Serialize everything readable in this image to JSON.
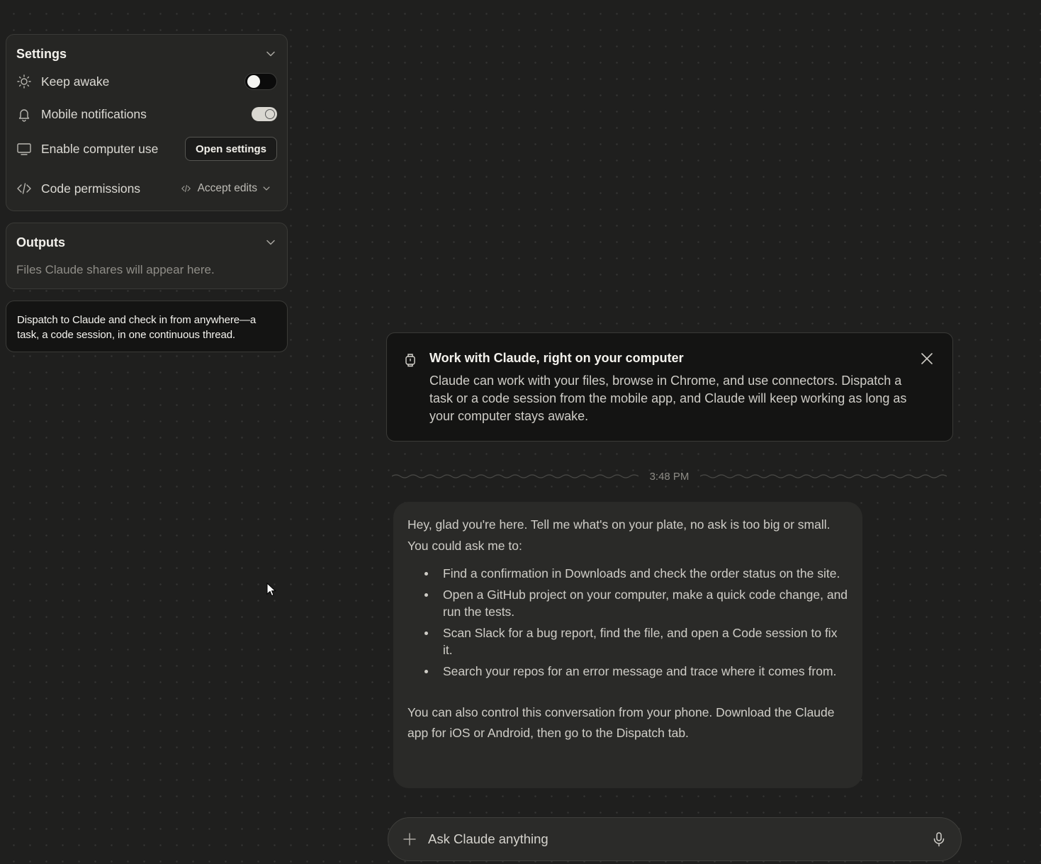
{
  "settings": {
    "title": "Settings",
    "keep_awake": {
      "label": "Keep awake",
      "enabled": false
    },
    "mobile_notifications": {
      "label": "Mobile notifications",
      "enabled": true
    },
    "computer_use": {
      "label": "Enable computer use",
      "button": "Open settings"
    },
    "code_permissions": {
      "label": "Code permissions",
      "value": "Accept edits"
    }
  },
  "outputs": {
    "title": "Outputs",
    "empty": "Files Claude shares will appear here."
  },
  "hint": "Dispatch to Claude and check in from anywhere—a task, a code session, in one continuous thread.",
  "banner": {
    "title": "Work with Claude, right on your computer",
    "text": "Claude can work with your files, browse in Chrome, and use connectors. Dispatch a task or a code session from the mobile app, and Claude will keep working as long as your computer stays awake."
  },
  "timestamp": "3:48 PM",
  "message": {
    "intro": "Hey, glad you're here. Tell me what's on your plate, no ask is too big or small. You could ask me to:",
    "items": [
      "Find a confirmation in Downloads and check the order status on the site.",
      "Open a GitHub project on your computer, make a quick code change, and run the tests.",
      "Scan Slack for a bug report, find the file, and open a Code session to fix it.",
      "Search your repos for an error message and trace where it comes from."
    ],
    "outro": "You can also control this conversation from your phone. Download the Claude app for iOS or Android, then go to the Dispatch tab."
  },
  "composer": {
    "placeholder": "Ask Claude anything"
  },
  "colors": {
    "background": "#1f1f1e",
    "panel": "#262624",
    "banner": "#141413",
    "message": "#2a2a28"
  },
  "icons": [
    "sun-icon",
    "bell-icon",
    "monitor-icon",
    "code-icon",
    "chevron-down-icon",
    "watch-icon",
    "close-icon",
    "plus-icon",
    "microphone-icon"
  ]
}
